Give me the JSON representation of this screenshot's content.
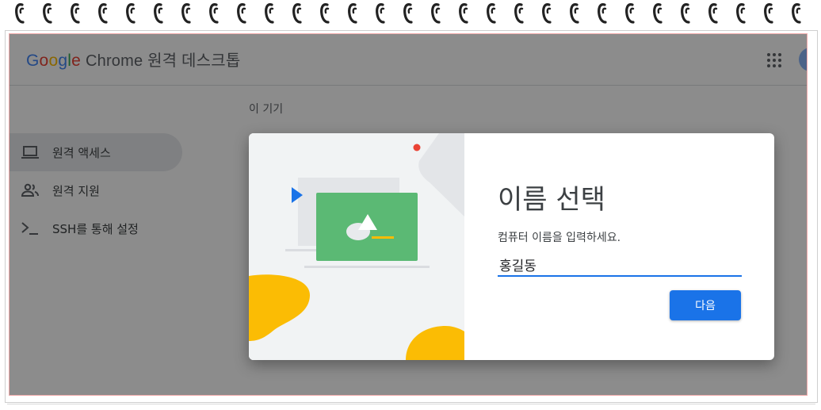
{
  "header": {
    "logo_g1": "G",
    "logo_o1": "o",
    "logo_o2": "o",
    "logo_g2": "g",
    "logo_l": "l",
    "logo_e": "e",
    "title_rest": "Chrome 원격 데스크톱"
  },
  "nav": {
    "items": [
      {
        "label": "원격 액세스",
        "icon": "laptop-icon",
        "active": true
      },
      {
        "label": "원격 지원",
        "icon": "people-icon",
        "active": false
      },
      {
        "label": "SSH를 통해 설정",
        "icon": "terminal-icon",
        "active": false
      }
    ]
  },
  "main": {
    "section_title": "이 기기"
  },
  "dialog": {
    "title": "이름 선택",
    "description": "컴퓨터 이름을 입력하세요.",
    "input_value": "홍길동",
    "next_label": "다음"
  },
  "colors": {
    "accent": "#1a73e8",
    "illustration_green": "#5bb974",
    "illustration_yellow": "#fbbc04",
    "dot_red": "#ea4335"
  }
}
